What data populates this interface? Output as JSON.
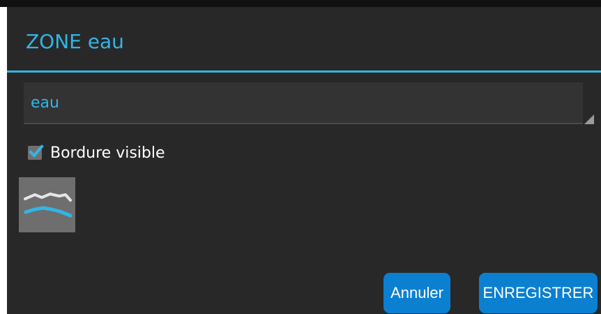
{
  "dialog": {
    "title": "ZONE eau",
    "name_field": {
      "value": "eau"
    },
    "border_checkbox": {
      "label": "Bordure visible",
      "checked": true
    },
    "zone_icon": {
      "icon": "water-waves-icon",
      "wave_colors": [
        "#e6e6e6",
        "#33b5e5"
      ]
    },
    "buttons": {
      "cancel_label": "Annuler",
      "save_label": "ENREGISTRER"
    }
  },
  "colors": {
    "accent": "#33b5e5",
    "dialog_background": "#282828",
    "button": "#0b80d1"
  }
}
